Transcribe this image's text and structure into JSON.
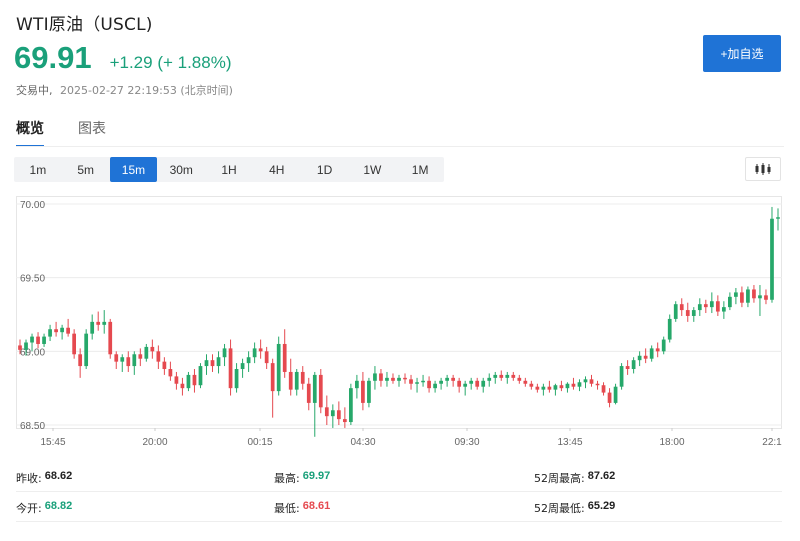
{
  "header": {
    "title": "WTI原油（USCL)",
    "price": "69.91",
    "change": "+1.29 (+ 1.88%)",
    "status": "交易中,",
    "timestamp": "2025-02-27 22:19:53 (北京时间)"
  },
  "watch_button": {
    "label": "+加自选"
  },
  "tabs": [
    {
      "label": "概览",
      "active": true
    },
    {
      "label": "图表",
      "active": false
    }
  ],
  "ranges": [
    "1m",
    "5m",
    "15m",
    "30m",
    "1H",
    "4H",
    "1D",
    "1W",
    "1M"
  ],
  "active_range": "15m",
  "colors": {
    "up": "#26a86a",
    "down": "#e5494f",
    "accent": "#1f73d6",
    "price": "#1aa07a"
  },
  "chart_data": {
    "type": "candlestick",
    "y_ticks": [
      "70.00",
      "69.50",
      "69.00",
      "68.50"
    ],
    "ylim": [
      68.5,
      70.0
    ],
    "x_ticks": [
      "15:45",
      "20:00",
      "00:15",
      "04:30",
      "09:30",
      "13:45",
      "18:00",
      "22:1"
    ],
    "candles": [
      [
        69.04,
        69.08,
        68.98,
        69.01
      ],
      [
        69.01,
        69.08,
        68.97,
        69.06
      ],
      [
        69.06,
        69.12,
        69.0,
        69.1
      ],
      [
        69.1,
        69.13,
        69.02,
        69.05
      ],
      [
        69.05,
        69.12,
        69.03,
        69.1
      ],
      [
        69.1,
        69.18,
        69.07,
        69.15
      ],
      [
        69.15,
        69.2,
        69.1,
        69.13
      ],
      [
        69.13,
        69.18,
        69.08,
        69.16
      ],
      [
        69.16,
        69.22,
        69.1,
        69.12
      ],
      [
        69.12,
        69.15,
        68.95,
        68.98
      ],
      [
        68.98,
        69.02,
        68.82,
        68.9
      ],
      [
        68.9,
        69.15,
        68.88,
        69.12
      ],
      [
        69.12,
        69.25,
        69.08,
        69.2
      ],
      [
        69.2,
        69.27,
        69.14,
        69.18
      ],
      [
        69.18,
        69.28,
        69.12,
        69.2
      ],
      [
        69.2,
        69.22,
        68.95,
        68.98
      ],
      [
        68.98,
        69.0,
        68.88,
        68.93
      ],
      [
        68.93,
        68.98,
        68.86,
        68.96
      ],
      [
        68.96,
        69.0,
        68.86,
        68.9
      ],
      [
        68.9,
        69.0,
        68.84,
        68.98
      ],
      [
        68.98,
        69.02,
        68.9,
        68.95
      ],
      [
        68.95,
        69.05,
        68.93,
        69.03
      ],
      [
        69.03,
        69.08,
        68.95,
        69.0
      ],
      [
        69.0,
        69.04,
        68.88,
        68.93
      ],
      [
        68.93,
        68.96,
        68.84,
        68.88
      ],
      [
        68.88,
        68.93,
        68.8,
        68.83
      ],
      [
        68.83,
        68.86,
        68.74,
        68.78
      ],
      [
        68.78,
        68.82,
        68.7,
        68.75
      ],
      [
        68.75,
        68.86,
        68.73,
        68.84
      ],
      [
        68.84,
        68.88,
        68.72,
        68.77
      ],
      [
        68.77,
        68.92,
        68.75,
        68.9
      ],
      [
        68.9,
        68.98,
        68.84,
        68.94
      ],
      [
        68.94,
        68.98,
        68.86,
        68.9
      ],
      [
        68.9,
        69.0,
        68.85,
        68.96
      ],
      [
        68.96,
        69.05,
        68.9,
        69.02
      ],
      [
        69.02,
        69.08,
        68.7,
        68.75
      ],
      [
        68.75,
        68.92,
        68.72,
        68.88
      ],
      [
        68.88,
        68.95,
        68.82,
        68.92
      ],
      [
        68.92,
        69.0,
        68.86,
        68.96
      ],
      [
        68.96,
        69.06,
        68.92,
        69.02
      ],
      [
        69.02,
        69.08,
        68.95,
        69.0
      ],
      [
        69.0,
        69.03,
        68.88,
        68.92
      ],
      [
        68.92,
        68.95,
        68.55,
        68.73
      ],
      [
        68.73,
        69.1,
        68.7,
        69.05
      ],
      [
        69.05,
        69.15,
        68.82,
        68.86
      ],
      [
        68.86,
        68.95,
        68.7,
        68.74
      ],
      [
        68.74,
        68.88,
        68.7,
        68.86
      ],
      [
        68.86,
        68.9,
        68.74,
        68.78
      ],
      [
        68.78,
        68.82,
        68.6,
        68.65
      ],
      [
        68.65,
        68.86,
        68.42,
        68.84
      ],
      [
        68.84,
        68.88,
        68.58,
        68.62
      ],
      [
        68.62,
        68.7,
        68.5,
        68.56
      ],
      [
        68.56,
        68.64,
        68.48,
        68.6
      ],
      [
        68.6,
        68.66,
        68.5,
        68.54
      ],
      [
        68.54,
        68.62,
        68.48,
        68.52
      ],
      [
        68.52,
        68.78,
        68.5,
        68.75
      ],
      [
        68.75,
        68.84,
        68.68,
        68.8
      ],
      [
        68.8,
        68.86,
        68.6,
        68.65
      ],
      [
        68.65,
        68.82,
        68.62,
        68.8
      ],
      [
        68.8,
        68.9,
        68.74,
        68.85
      ],
      [
        68.85,
        68.88,
        68.76,
        68.8
      ],
      [
        68.8,
        68.86,
        68.76,
        68.82
      ],
      [
        68.82,
        68.85,
        68.78,
        68.8
      ],
      [
        68.8,
        68.84,
        68.76,
        68.82
      ],
      [
        68.82,
        68.85,
        68.78,
        68.81
      ],
      [
        68.81,
        68.84,
        68.74,
        68.78
      ],
      [
        68.78,
        68.82,
        68.72,
        68.79
      ],
      [
        68.79,
        68.84,
        68.76,
        68.8
      ],
      [
        68.8,
        68.83,
        68.72,
        68.75
      ],
      [
        68.75,
        68.8,
        68.72,
        68.78
      ],
      [
        68.78,
        68.82,
        68.74,
        68.8
      ],
      [
        68.8,
        68.84,
        68.76,
        68.82
      ],
      [
        68.82,
        68.84,
        68.76,
        68.8
      ],
      [
        68.8,
        68.82,
        68.72,
        68.76
      ],
      [
        68.76,
        68.8,
        68.7,
        68.78
      ],
      [
        68.78,
        68.82,
        68.74,
        68.8
      ],
      [
        68.8,
        68.82,
        68.74,
        68.76
      ],
      [
        68.76,
        68.82,
        68.72,
        68.8
      ],
      [
        68.8,
        68.85,
        68.76,
        68.82
      ],
      [
        68.82,
        68.86,
        68.78,
        68.84
      ],
      [
        68.84,
        68.87,
        68.8,
        68.82
      ],
      [
        68.82,
        68.86,
        68.78,
        68.84
      ],
      [
        68.84,
        68.86,
        68.8,
        68.82
      ],
      [
        68.82,
        68.84,
        68.78,
        68.8
      ],
      [
        68.8,
        68.82,
        68.76,
        68.78
      ],
      [
        68.78,
        68.8,
        68.74,
        68.76
      ],
      [
        68.76,
        68.78,
        68.72,
        68.74
      ],
      [
        68.74,
        68.78,
        68.7,
        68.76
      ],
      [
        68.76,
        68.8,
        68.72,
        68.74
      ],
      [
        68.74,
        68.78,
        68.7,
        68.77
      ],
      [
        68.77,
        68.8,
        68.73,
        68.75
      ],
      [
        68.75,
        68.79,
        68.72,
        68.78
      ],
      [
        68.78,
        68.82,
        68.74,
        68.76
      ],
      [
        68.76,
        68.81,
        68.73,
        68.79
      ],
      [
        68.79,
        68.83,
        68.75,
        68.81
      ],
      [
        68.81,
        68.84,
        68.76,
        68.78
      ],
      [
        68.78,
        68.8,
        68.74,
        68.77
      ],
      [
        68.77,
        68.79,
        68.7,
        68.72
      ],
      [
        68.72,
        68.75,
        68.62,
        68.65
      ],
      [
        68.65,
        68.78,
        68.64,
        68.76
      ],
      [
        68.76,
        68.92,
        68.74,
        68.9
      ],
      [
        68.9,
        68.94,
        68.84,
        68.88
      ],
      [
        68.88,
        68.96,
        68.85,
        68.94
      ],
      [
        68.94,
        69.0,
        68.9,
        68.97
      ],
      [
        68.97,
        69.02,
        68.92,
        68.95
      ],
      [
        68.95,
        69.04,
        68.93,
        69.02
      ],
      [
        69.02,
        69.06,
        68.96,
        69.0
      ],
      [
        69.0,
        69.1,
        68.98,
        69.08
      ],
      [
        69.08,
        69.25,
        69.06,
        69.22
      ],
      [
        69.22,
        69.34,
        69.2,
        69.32
      ],
      [
        69.32,
        69.36,
        69.24,
        69.28
      ],
      [
        69.28,
        69.33,
        69.2,
        69.24
      ],
      [
        69.24,
        69.3,
        69.2,
        69.28
      ],
      [
        69.28,
        69.36,
        69.24,
        69.32
      ],
      [
        69.32,
        69.35,
        69.26,
        69.3
      ],
      [
        69.3,
        69.4,
        69.26,
        69.34
      ],
      [
        69.34,
        69.38,
        69.24,
        69.27
      ],
      [
        69.27,
        69.34,
        69.22,
        69.3
      ],
      [
        69.3,
        69.4,
        69.28,
        69.37
      ],
      [
        69.37,
        69.43,
        69.32,
        69.4
      ],
      [
        69.4,
        69.44,
        69.3,
        69.33
      ],
      [
        69.33,
        69.44,
        69.3,
        69.42
      ],
      [
        69.42,
        69.45,
        69.33,
        69.36
      ],
      [
        69.36,
        69.45,
        69.24,
        69.38
      ],
      [
        69.38,
        69.42,
        69.32,
        69.35
      ],
      [
        69.35,
        69.98,
        69.33,
        69.9
      ],
      [
        69.9,
        69.97,
        69.82,
        69.91
      ]
    ]
  },
  "stats": {
    "prev_close": {
      "label": "昨收:",
      "value": "68.62"
    },
    "high": {
      "label": "最高:",
      "value": "69.97"
    },
    "week52_high": {
      "label": "52周最高:",
      "value": "87.62"
    },
    "open": {
      "label": "今开:",
      "value": "68.82"
    },
    "low": {
      "label": "最低:",
      "value": "68.61"
    },
    "week52_low": {
      "label": "52周最低:",
      "value": "65.29"
    }
  }
}
